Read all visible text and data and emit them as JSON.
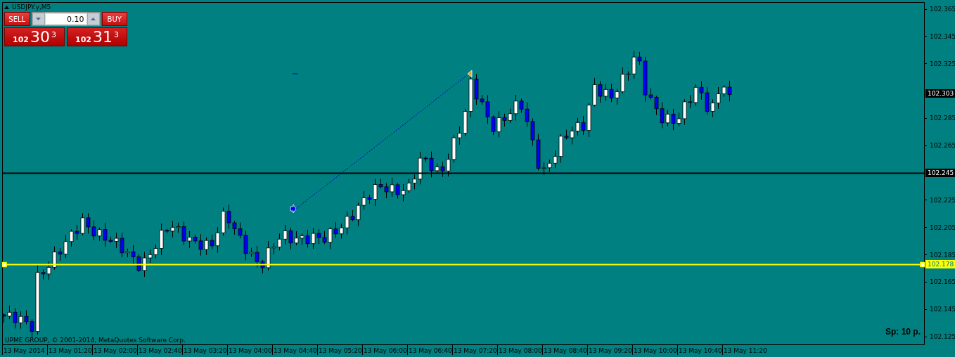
{
  "symbol_title": "USDJPY.y,M5",
  "trade_panel": {
    "sell_label": "SELL",
    "buy_label": "BUY",
    "lot": "0.10",
    "sell_price": {
      "big_figure": "102",
      "pips": "30",
      "fraction": "3"
    },
    "buy_price": {
      "big_figure": "102",
      "pips": "31",
      "fraction": "3"
    }
  },
  "price_ticks": [
    "102.365",
    "102.345",
    "102.325",
    "102.285",
    "102.265",
    "102.225",
    "102.205",
    "102.185",
    "102.165",
    "102.145",
    "102.125"
  ],
  "bid_label": "102.303",
  "horizontal_lines": [
    {
      "label": "102.245",
      "color": "#000000",
      "selected": false
    },
    {
      "label": "102.178",
      "color": "#ffff00",
      "selected": true
    }
  ],
  "time_labels": [
    "13 May 2014",
    "13 May 01:20",
    "13 May 02:00",
    "13 May 02:40",
    "13 May 03:20",
    "13 May 04:00",
    "13 May 04:40",
    "13 May 05:20",
    "13 May 06:00",
    "13 May 06:40",
    "13 May 07:20",
    "13 May 08:00",
    "13 May 08:40",
    "13 May 09:20",
    "13 May 10:00",
    "13 May 10:40",
    "13 May 11:20"
  ],
  "copyright": "UPME GROUP, © 2001-2014, MetaQuotes Software Corp.",
  "spread": "Sp: 10 p."
}
